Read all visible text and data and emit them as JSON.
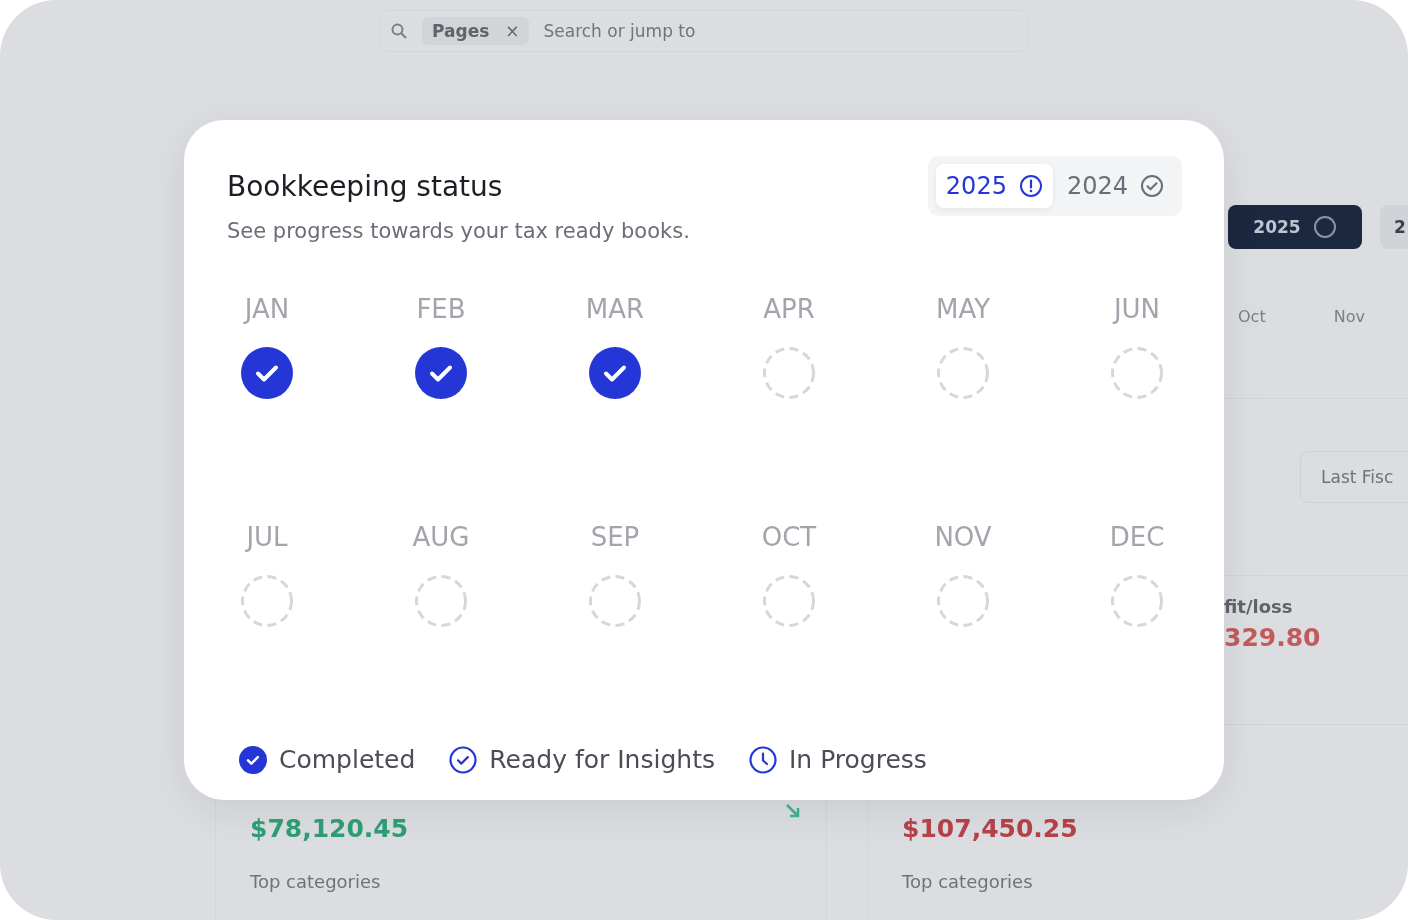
{
  "background": {
    "search": {
      "chip": "Pages",
      "chip_close": "×",
      "placeholder": "Search or jump to"
    },
    "year_buttons": [
      {
        "label": "2025",
        "selected": true
      },
      {
        "label": "2",
        "selected": false
      }
    ],
    "months": [
      "Oct",
      "Nov"
    ],
    "period_button": "Last Fisc",
    "profit_label": "fit/loss",
    "profit_value": "329.80",
    "cards": [
      {
        "amount": "$78,120.45",
        "color": "#2f9e74",
        "caption": "Top categories"
      },
      {
        "amount": "$107,450.25",
        "color": "#b8414a",
        "caption": "Top categories"
      }
    ]
  },
  "dialog": {
    "title": "Bookkeeping status",
    "subtitle": "See progress towards your tax ready books.",
    "years": [
      {
        "label": "2025",
        "selected": true,
        "kind": "attention"
      },
      {
        "label": "2024",
        "selected": false,
        "kind": "done"
      }
    ],
    "months": [
      {
        "label": "JAN",
        "completed": true
      },
      {
        "label": "FEB",
        "completed": true
      },
      {
        "label": "MAR",
        "completed": true
      },
      {
        "label": "APR",
        "completed": false
      },
      {
        "label": "MAY",
        "completed": false
      },
      {
        "label": "JUN",
        "completed": false
      },
      {
        "label": "JUL",
        "completed": false
      },
      {
        "label": "AUG",
        "completed": false
      },
      {
        "label": "SEP",
        "completed": false
      },
      {
        "label": "OCT",
        "completed": false
      },
      {
        "label": "NOV",
        "completed": false
      },
      {
        "label": "DEC",
        "completed": false
      }
    ],
    "legend": [
      {
        "label": "Completed",
        "kind": "completed"
      },
      {
        "label": "Ready for Insights",
        "kind": "ready"
      },
      {
        "label": "In Progress",
        "kind": "in_progress"
      }
    ]
  }
}
